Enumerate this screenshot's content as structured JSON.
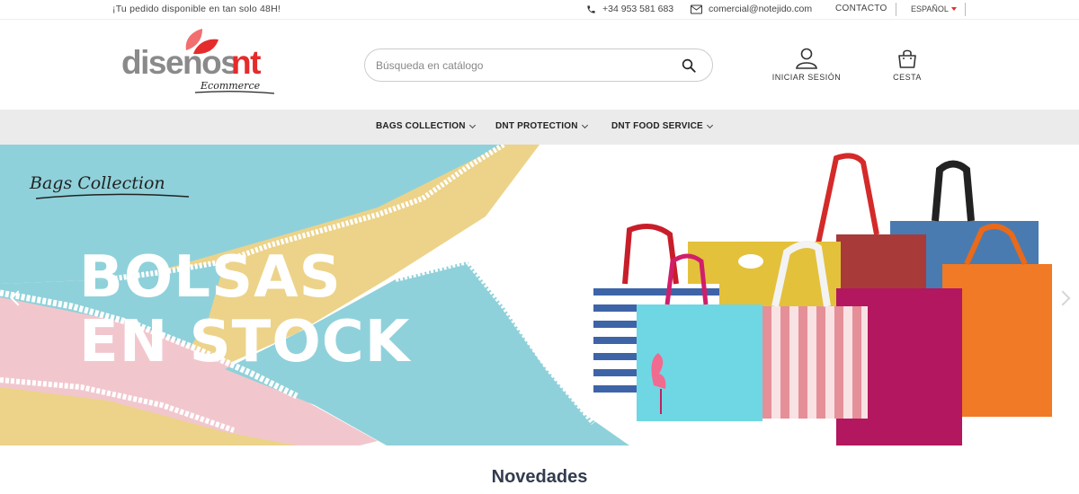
{
  "topbar": {
    "promo": "¡Tu pedido disponible en tan solo 48H!",
    "phone": "+34 953 581 683",
    "email": "comercial@notejido.com",
    "contact": "CONTACTO",
    "language": "ESPAÑOL",
    "icons": {
      "phone": "phone-icon",
      "email": "envelope-icon",
      "language": "caret-down-icon"
    }
  },
  "header": {
    "logo_text": "disenosnt",
    "logo_subtext": "Ecommerce",
    "search_placeholder": "Búsqueda en catálogo",
    "login_label": "INICIAR SESIÓN",
    "cart_label": "CESTA"
  },
  "nav": {
    "items": [
      {
        "label": "BAGS COLLECTION"
      },
      {
        "label": "DNT PROTECTION"
      },
      {
        "label": "DNT FOOD SERVICE"
      }
    ]
  },
  "hero": {
    "script_title": "Bags Collection",
    "headline_line1": "BOLSAS",
    "headline_line2": "EN STOCK"
  },
  "section_title": "Novedades",
  "colors": {
    "brand_red": "#e52b2b",
    "nav_bg": "#ebebeb",
    "hero_blue": "#8fd1da",
    "hero_yellow": "#ecd389",
    "hero_pink": "#f1c7cd"
  }
}
